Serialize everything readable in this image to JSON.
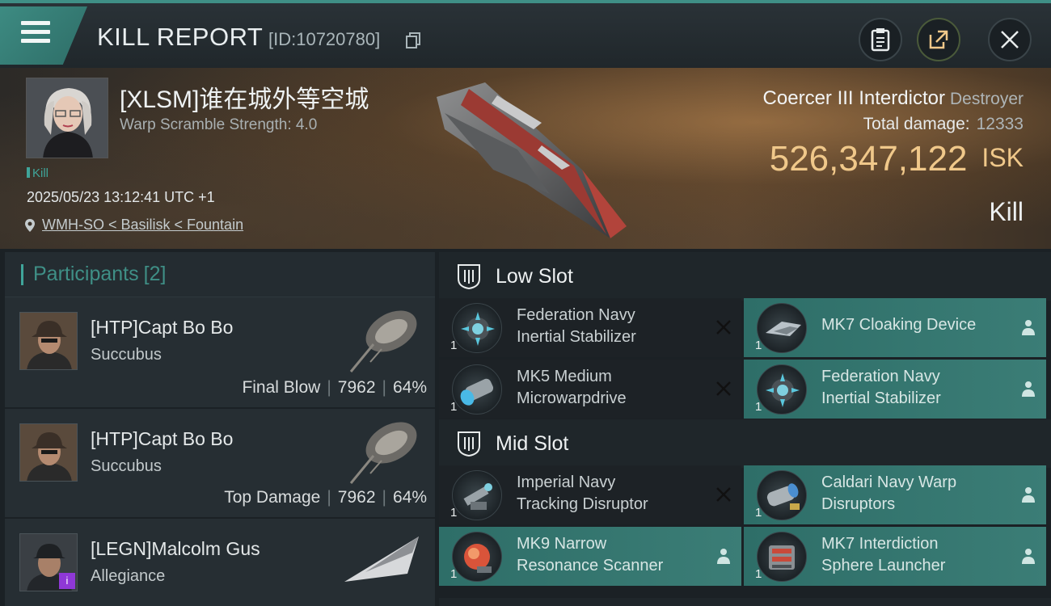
{
  "header": {
    "title": "KILL REPORT",
    "report_id": "[ID:10720780]"
  },
  "victim": {
    "pilot": "[XLSM]谁在城外等空城",
    "warp_scramble": "Warp Scramble Strength: 4.0",
    "tag": "Kill",
    "datetime": "2025/05/23 13:12:41 UTC +1",
    "location": "WMH-SO < Basilisk < Fountain",
    "ship": "Coercer III Interdictor",
    "ship_class": "Destroyer",
    "total_damage_label": "Total damage:",
    "total_damage": "12333",
    "isk_value": "526,347,122",
    "isk_unit": "ISK",
    "result": "Kill"
  },
  "participants": {
    "label": "Participants",
    "count": "[2]",
    "rows": [
      {
        "name": "[HTP]Capt Bo Bo",
        "ship": "Succubus",
        "role": "Final Blow",
        "damage": "7962",
        "percent": "64%"
      },
      {
        "name": "[HTP]Capt Bo Bo",
        "ship": "Succubus",
        "role": "Top Damage",
        "damage": "7962",
        "percent": "64%"
      },
      {
        "name": "[LEGN]Malcolm Gus",
        "ship": "Allegiance",
        "alliance_badge": "i"
      }
    ]
  },
  "slots": {
    "low": {
      "label": "Low Slot",
      "modules": [
        {
          "qty": "1",
          "line1": "Federation Navy",
          "line2": "Inertial Stabilizer",
          "state": "destroyed"
        },
        {
          "qty": "1",
          "line1": "MK7 Cloaking Device",
          "line2": "",
          "state": "dropped"
        },
        {
          "qty": "1",
          "line1": "MK5 Medium",
          "line2": "Microwarpdrive",
          "state": "destroyed"
        },
        {
          "qty": "1",
          "line1": "Federation Navy",
          "line2": "Inertial Stabilizer",
          "state": "dropped"
        }
      ]
    },
    "mid": {
      "label": "Mid Slot",
      "modules": [
        {
          "qty": "1",
          "line1": "Imperial Navy",
          "line2": "Tracking Disruptor",
          "state": "destroyed"
        },
        {
          "qty": "1",
          "line1": "Caldari Navy Warp",
          "line2": "Disruptors",
          "state": "dropped"
        },
        {
          "qty": "1",
          "line1": "MK9 Narrow",
          "line2": "Resonance Scanner",
          "state": "dropped"
        },
        {
          "qty": "1",
          "line1": "MK7 Interdiction",
          "line2": "Sphere Launcher",
          "state": "dropped"
        }
      ]
    }
  },
  "colors": {
    "accent_teal": "#3fa59a",
    "isk_gold": "#f0c88a",
    "dropped_bg": "#2e6e68",
    "destroyed_bg": "#1d2226"
  },
  "icons": [
    "menu-icon",
    "copy-icon",
    "clipboard-icon",
    "share-icon",
    "close-icon",
    "location-pin-icon",
    "slot-shield-icon",
    "destroyed-x-icon",
    "pilot-icon"
  ]
}
